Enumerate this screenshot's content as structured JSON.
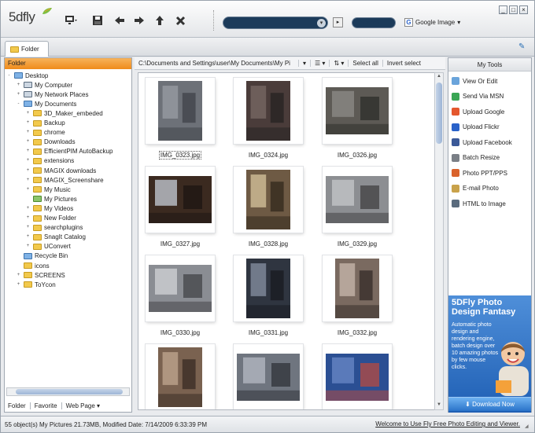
{
  "app": {
    "logo": "5dfly"
  },
  "toolbar": {
    "search_label": "Search",
    "google_image_label": "Google Image",
    "window_buttons": [
      "_",
      "□",
      "×"
    ]
  },
  "tabs": {
    "folder_tab": "Folder"
  },
  "left_panel": {
    "header": "Folder",
    "tree": [
      {
        "label": "Desktop",
        "depth": 0,
        "expander": "-",
        "icon": "desktop-icon"
      },
      {
        "label": "My Computer",
        "depth": 1,
        "expander": "+",
        "icon": "computer-icon"
      },
      {
        "label": "My Network Places",
        "depth": 1,
        "expander": "+",
        "icon": "network-icon"
      },
      {
        "label": "My Documents",
        "depth": 1,
        "expander": "-",
        "icon": "documents-icon"
      },
      {
        "label": "3D_Maker_embeded",
        "depth": 2,
        "expander": "+",
        "icon": "folder-icon"
      },
      {
        "label": "Backup",
        "depth": 2,
        "expander": "+",
        "icon": "folder-icon"
      },
      {
        "label": "chrome",
        "depth": 2,
        "expander": "+",
        "icon": "folder-icon"
      },
      {
        "label": "Downloads",
        "depth": 2,
        "expander": "+",
        "icon": "folder-icon"
      },
      {
        "label": "EfficientPIM AutoBackup",
        "depth": 2,
        "expander": "+",
        "icon": "folder-icon"
      },
      {
        "label": "extensions",
        "depth": 2,
        "expander": "+",
        "icon": "folder-icon"
      },
      {
        "label": "MAGIX downloads",
        "depth": 2,
        "expander": "+",
        "icon": "folder-icon"
      },
      {
        "label": "MAGIX_Screenshare",
        "depth": 2,
        "expander": "+",
        "icon": "folder-icon"
      },
      {
        "label": "My Music",
        "depth": 2,
        "expander": "+",
        "icon": "music-folder-icon"
      },
      {
        "label": "My Pictures",
        "depth": 2,
        "expander": "",
        "icon": "pictures-folder-icon"
      },
      {
        "label": "My Videos",
        "depth": 2,
        "expander": "+",
        "icon": "videos-folder-icon"
      },
      {
        "label": "New Folder",
        "depth": 2,
        "expander": "+",
        "icon": "folder-icon"
      },
      {
        "label": "searchplugins",
        "depth": 2,
        "expander": "+",
        "icon": "folder-icon"
      },
      {
        "label": "SnagIt Catalog",
        "depth": 2,
        "expander": "+",
        "icon": "folder-icon"
      },
      {
        "label": "UConvert",
        "depth": 2,
        "expander": "+",
        "icon": "folder-icon"
      },
      {
        "label": "Recycle Bin",
        "depth": 1,
        "expander": "",
        "icon": "recycle-bin-icon"
      },
      {
        "label": "icons",
        "depth": 1,
        "expander": "",
        "icon": "folder-icon"
      },
      {
        "label": "SCREENS",
        "depth": 1,
        "expander": "+",
        "icon": "folder-icon"
      },
      {
        "label": "ToYcon",
        "depth": 1,
        "expander": "+",
        "icon": "folder-icon"
      }
    ],
    "bottom_tabs": [
      "Folder",
      "Favorite",
      "Web Page ▾"
    ]
  },
  "address_bar": {
    "path": "C:\\Documents and Settings\\user\\My Documents\\My Pi",
    "select_all": "Select all",
    "invert_select": "Invert select"
  },
  "thumbnails": [
    {
      "name": "IMG_0323.jpg",
      "selected": true,
      "palette": [
        "#6d7178",
        "#9a9ea4",
        "#3c3f44"
      ]
    },
    {
      "name": "IMG_0324.jpg",
      "selected": false,
      "palette": [
        "#4a3c3a",
        "#7a6a66",
        "#22201f"
      ]
    },
    {
      "name": "IMG_0326.jpg",
      "selected": false,
      "palette": [
        "#5d5a55",
        "#8e8c88",
        "#2a2926"
      ]
    },
    {
      "name": "IMG_0327.jpg",
      "selected": false,
      "palette": [
        "#3b2a20",
        "#c8cfd8",
        "#1b1411"
      ]
    },
    {
      "name": "IMG_0328.jpg",
      "selected": false,
      "palette": [
        "#6e5a44",
        "#d8c69e",
        "#2c2318"
      ]
    },
    {
      "name": "IMG_0329.jpg",
      "selected": false,
      "palette": [
        "#8c8e92",
        "#c5c7ca",
        "#3a3a3c"
      ]
    },
    {
      "name": "IMG_0330.jpg",
      "selected": false,
      "palette": [
        "#8a8d93",
        "#d2d4d7",
        "#3d3e42"
      ]
    },
    {
      "name": "IMG_0331.jpg",
      "selected": false,
      "palette": [
        "#2f3540",
        "#8892a3",
        "#15181d"
      ]
    },
    {
      "name": "IMG_0332.jpg",
      "selected": false,
      "palette": [
        "#7a6a60",
        "#c9b9ad",
        "#2f2723"
      ]
    },
    {
      "name": "",
      "selected": false,
      "palette": [
        "#7a6250",
        "#c2a890",
        "#33271f"
      ]
    },
    {
      "name": "",
      "selected": false,
      "palette": [
        "#6f757f",
        "#b5bbc4",
        "#2b2e33"
      ]
    },
    {
      "name": "",
      "selected": false,
      "palette": [
        "#2b4f93",
        "#6b88c7",
        "#c04a3a"
      ]
    }
  ],
  "tools": {
    "header": "My Tools",
    "items": [
      {
        "label": "View Or Edit",
        "icon": "view-edit-icon",
        "color": "#6aa4db"
      },
      {
        "label": "Send Via MSN",
        "icon": "msn-icon",
        "color": "#3aa655"
      },
      {
        "label": "Upload Google",
        "icon": "google-icon",
        "color": "#e4572e"
      },
      {
        "label": "Upload Flickr",
        "icon": "flickr-icon",
        "color": "#2a62c9"
      },
      {
        "label": "Upload Facebook",
        "icon": "facebook-icon",
        "color": "#3b5998"
      },
      {
        "label": "Batch Resize",
        "icon": "batch-resize-icon",
        "color": "#7a7f86"
      },
      {
        "label": "Photo PPT/PPS",
        "icon": "ppt-icon",
        "color": "#d9622b"
      },
      {
        "label": "E-mail Photo",
        "icon": "email-icon",
        "color": "#c9a24a"
      },
      {
        "label": "HTML to Image",
        "icon": "html-icon",
        "color": "#5a6b7d"
      }
    ]
  },
  "ad": {
    "title": "5DFly Photo Design Fantasy",
    "body": "Automatic photo design and rendering engine, batch design over 10 amazing photos by few mouse clicks.",
    "download_label": "Download Now"
  },
  "status": {
    "text": "55 object(s)   My Pictures   21.73MB, Modified Date: 7/14/2009 6:33:39 PM",
    "welcome": "Welcome to Use Fly Free Photo Editing and Viewer."
  },
  "colors": {
    "accent_orange": "#ef8b1b",
    "navy": "#1c3b5a",
    "ad_blue": "#1f5fb4"
  }
}
